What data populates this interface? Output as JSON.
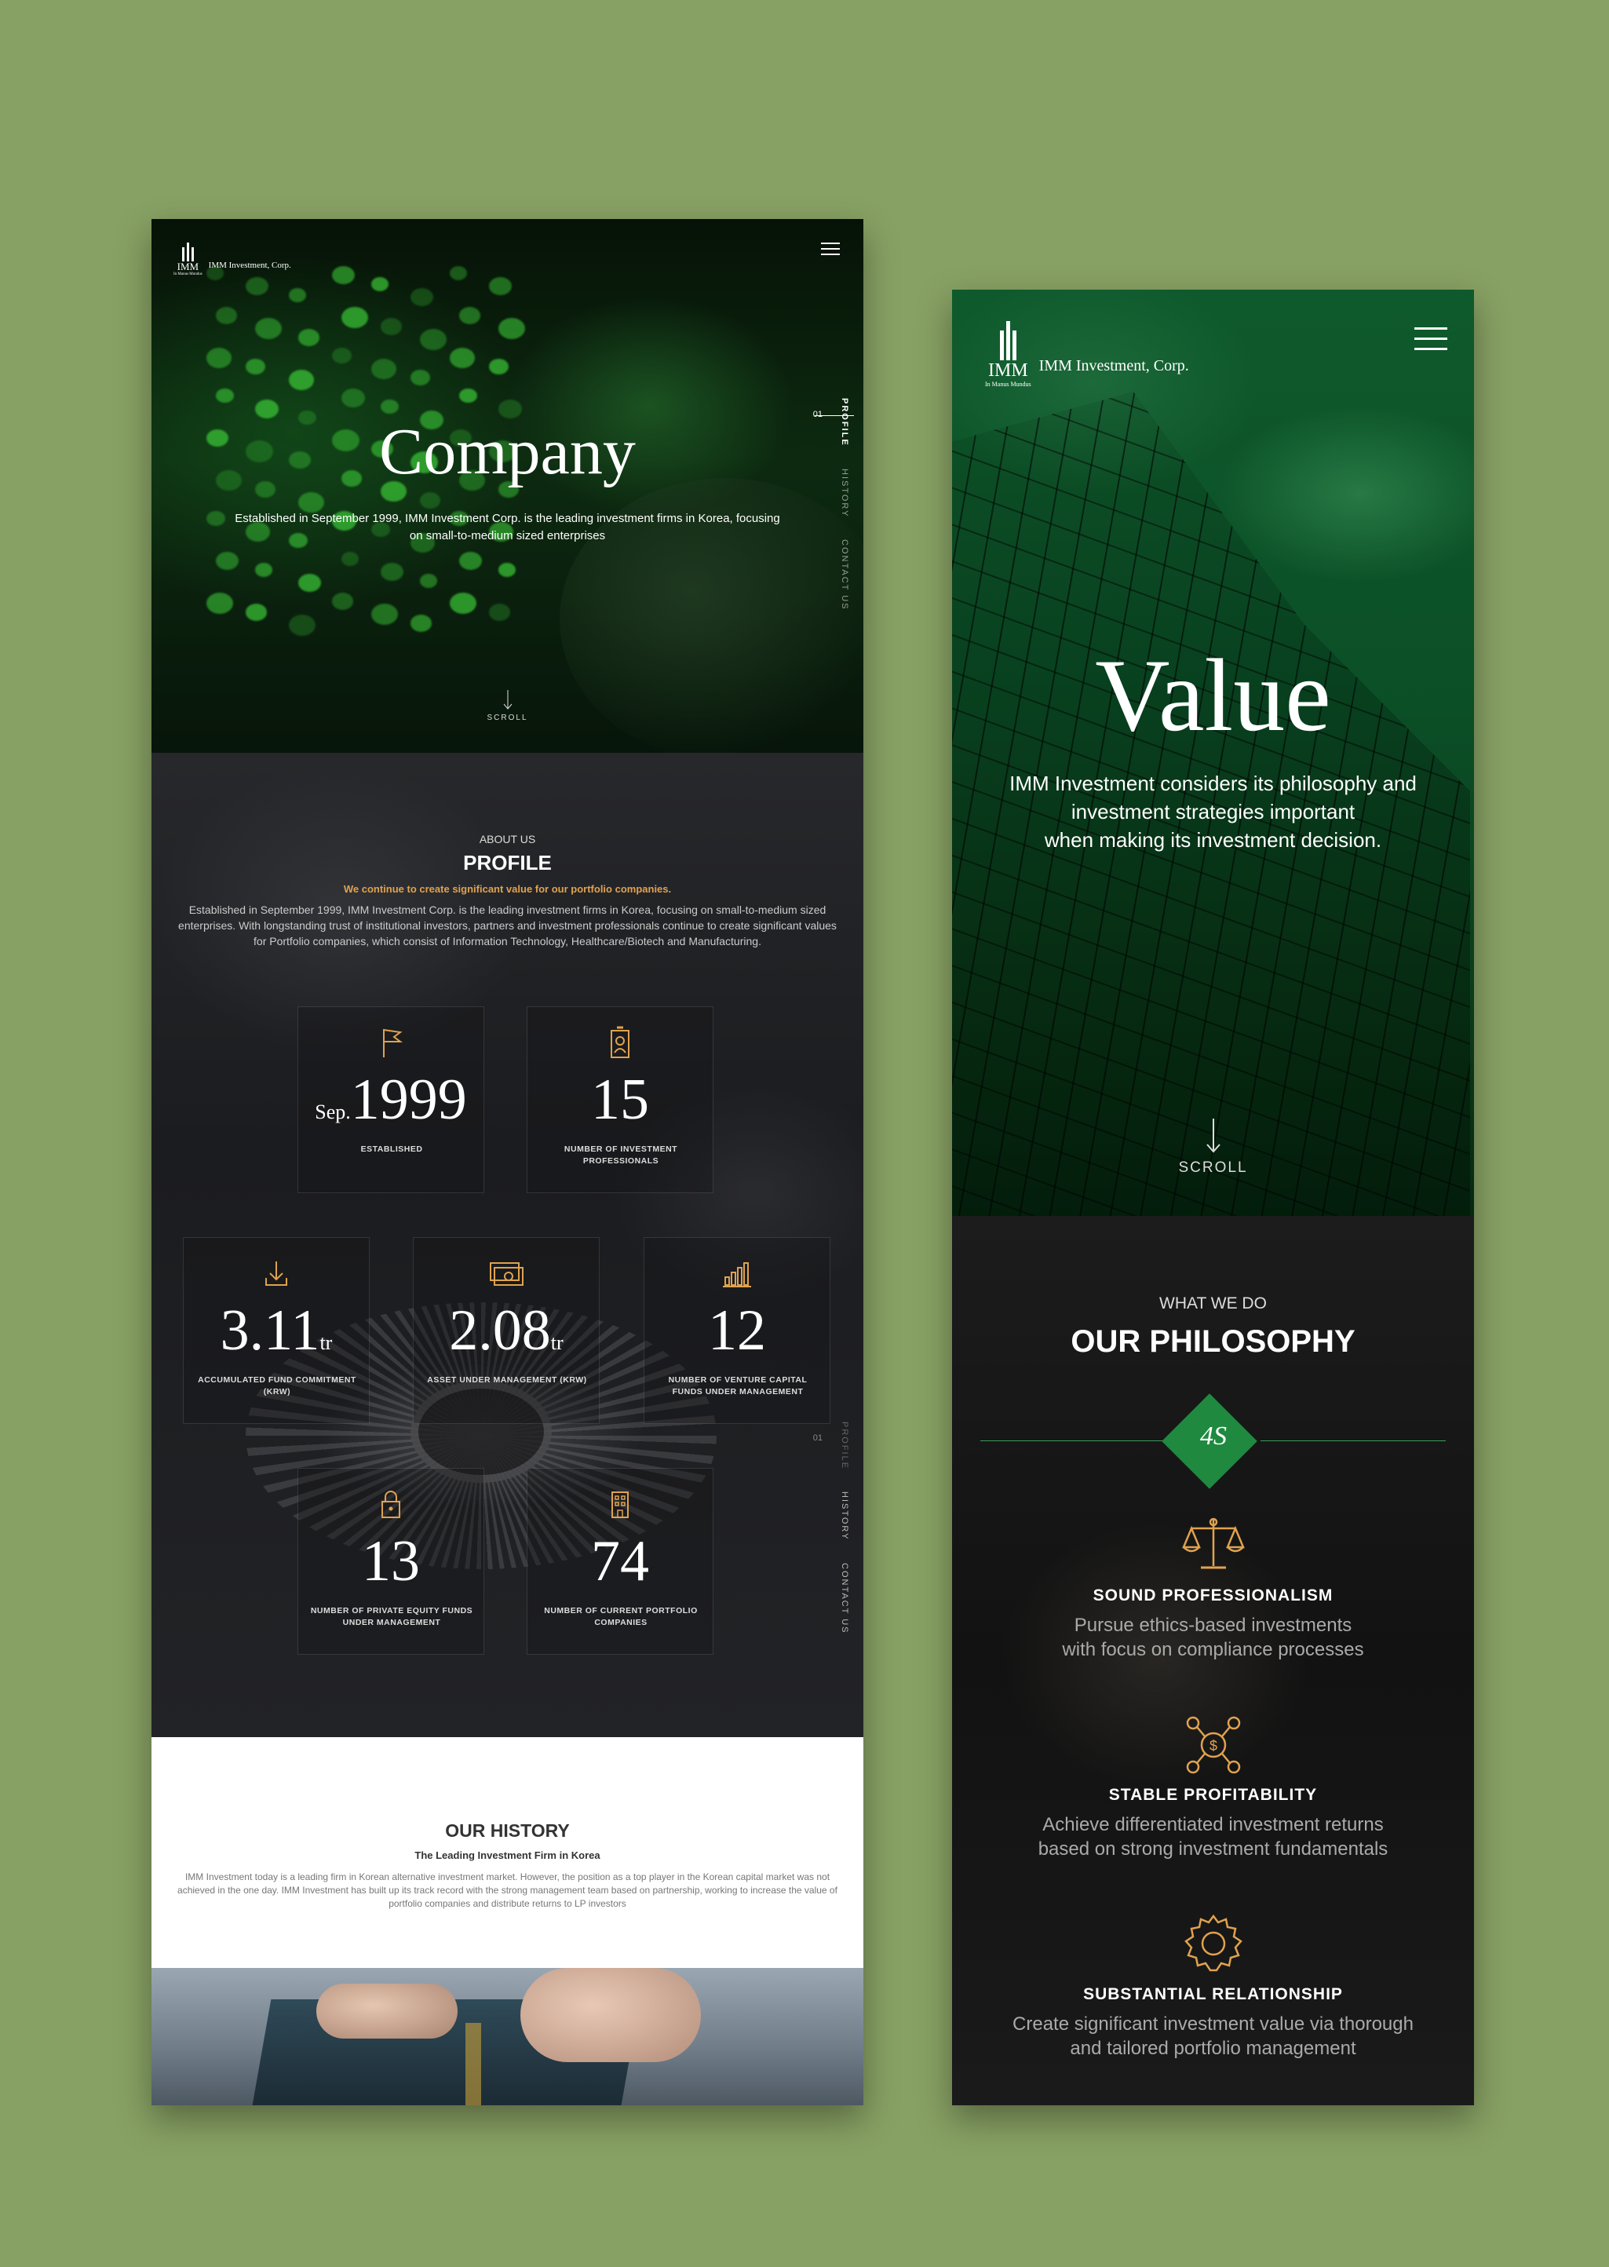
{
  "left": {
    "brand": {
      "logo_text": "IMM",
      "logo_motto": "In Manus Mundus",
      "company": "IMM Investment, Corp."
    },
    "side_nav": {
      "number": "01",
      "items": [
        "PROFILE",
        "HISTORY",
        "CONTACT US"
      ]
    },
    "hero": {
      "title": "Company",
      "subtitle": "Established in September 1999, IMM Investment Corp. is the leading  investment firms in Korea, focusing on small-to-medium sized enterprises",
      "scroll": "SCROLL"
    },
    "profile": {
      "eyebrow": "ABOUT US",
      "title": "PROFILE",
      "tagline": "We continue to create significant value for our portfolio companies.",
      "body": "Established in September 1999, IMM Investment Corp. is the leading investment firms in Korea, focusing on small-to-medium sized enterprises. With longstanding trust of institutional investors, partners and investment professionals continue to create significant values for Portfolio companies, which consist of Information Technology, Healthcare/Biotech and Manufacturing.",
      "stats": [
        {
          "icon": "flag-icon",
          "prefix": "Sep.",
          "value": "1999",
          "suffix": "",
          "label": "ESTABLISHED"
        },
        {
          "icon": "id-badge-icon",
          "prefix": "",
          "value": "15",
          "suffix": "",
          "label": "NUMBER OF INVESTMENT PROFESSIONALS"
        },
        {
          "icon": "download-icon",
          "prefix": "",
          "value": "3.11",
          "suffix": "tr",
          "label": "ACCUMULATED FUND COMMITMENT (KRW)"
        },
        {
          "icon": "banknote-icon",
          "prefix": "",
          "value": "2.08",
          "suffix": "tr",
          "label": "ASSET UNDER MANAGEMENT (KRW)"
        },
        {
          "icon": "bar-chart-icon",
          "prefix": "",
          "value": "12",
          "suffix": "",
          "label": "NUMBER OF VENTURE CAPITAL FUNDS UNDER MANAGEMENT"
        },
        {
          "icon": "lock-icon",
          "prefix": "",
          "value": "13",
          "suffix": "",
          "label": "NUMBER OF PRIVATE EQUITY FUNDS UNDER MANAGEMENT"
        },
        {
          "icon": "building-icon",
          "prefix": "",
          "value": "74",
          "suffix": "",
          "label": "NUMBER OF CURRENT PORTFOLIO COMPANIES"
        }
      ]
    },
    "history": {
      "title": "OUR HISTORY",
      "subtitle": "The Leading Investment Firm in Korea",
      "body": "IMM Investment today is a leading firm in Korean alternative investment market. However, the position as a top player in the Korean capital market was not achieved in the one day. IMM Investment has built up its track record with the strong management team based on partnership, working to increase the value of portfolio companies and distribute returns to LP investors"
    }
  },
  "right": {
    "brand": {
      "logo_text": "IMM",
      "logo_motto": "In Manus Mundus",
      "company": "IMM Investment, Corp."
    },
    "hero": {
      "title": "Value",
      "subtitle_lines": [
        "IMM Investment considers its philosophy and",
        "investment strategies important",
        "when making its investment decision."
      ],
      "scroll": "SCROLL"
    },
    "philosophy": {
      "eyebrow": "WHAT WE DO",
      "title": "OUR PHILOSOPHY",
      "badge": "4S",
      "items": [
        {
          "icon": "scales-icon",
          "title": "SOUND PROFESSIONALISM",
          "desc": [
            "Pursue ethics-based investments",
            "with focus on compliance processes"
          ]
        },
        {
          "icon": "network-dollar-icon",
          "title": "STABLE PROFITABILITY",
          "desc": [
            "Achieve differentiated investment returns",
            "based on strong investment fundamentals"
          ]
        },
        {
          "icon": "gear-icon",
          "title": "SUBSTANTIAL RELATIONSHIP",
          "desc": [
            "Create significant investment value via thorough",
            "and tailored portfolio management"
          ]
        }
      ]
    }
  },
  "colors": {
    "background": "#87a063",
    "accent_gold": "#e0a24f",
    "accent_green": "#1f8a3f"
  }
}
